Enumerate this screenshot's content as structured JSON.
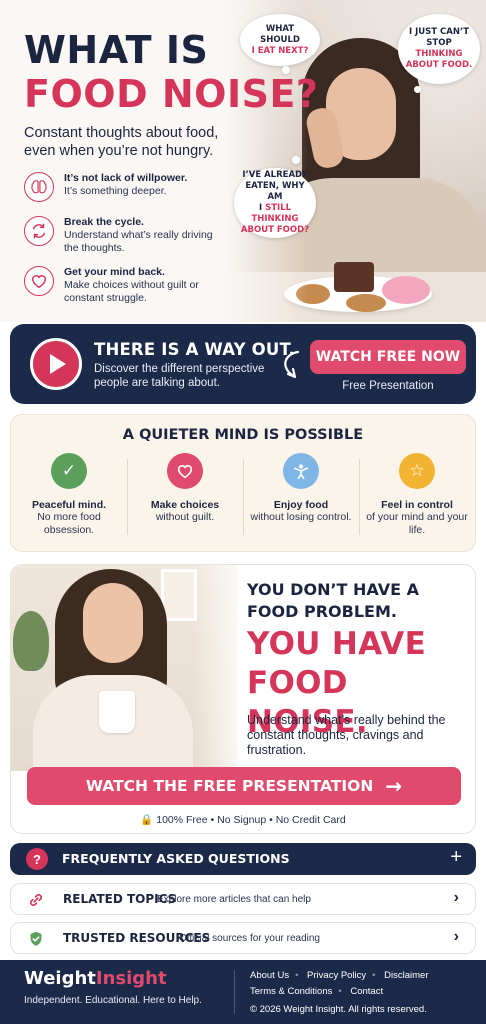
{
  "hero": {
    "title_line1": "WHAT IS",
    "title_line2": "FOOD NOISE?",
    "subtitle": "Constant thoughts about food, even when you’re not hungry.",
    "bubbles": {
      "b1_line1": "WHAT SHOULD",
      "b1_line2": "I EAT NEXT?",
      "b2_line1": "I JUST CAN’T",
      "b2_line2a": "STOP",
      "b2_line2b": "THINKING",
      "b2_line3": "ABOUT FOOD.",
      "b3_line1": "I’VE ALREADY",
      "b3_line2": "EATEN, WHY AM",
      "b3_line3a": "I",
      "b3_line3b": "STILL THINKING",
      "b3_line4": "ABOUT FOOD?"
    },
    "features": [
      {
        "title": "It’s not lack of willpower.",
        "text": "It’s something deeper.",
        "icon": "brain-icon"
      },
      {
        "title": "Break the cycle.",
        "text": "Understand what’s really driving the thoughts.",
        "icon": "cycle-icon"
      },
      {
        "title": "Get your mind back.",
        "text": "Make choices without guilt or constant struggle.",
        "icon": "heart-icon"
      }
    ]
  },
  "wayout": {
    "heading": "THERE IS A WAY OUT.",
    "text": "Discover the different perspective people are talking about.",
    "button": "WATCH FREE NOW",
    "button_sub": "Free Presentation"
  },
  "quiet": {
    "heading": "A QUIETER MIND IS POSSIBLE",
    "items": [
      {
        "title": "Peaceful mind.",
        "text": "No more food obsession.",
        "color": "#5aa05a",
        "icon": "check-icon"
      },
      {
        "title": "Make choices",
        "text": "without guilt.",
        "color": "#e04a6c",
        "icon": "heart-icon"
      },
      {
        "title": "Enjoy food",
        "text": "without losing control.",
        "color": "#7fb6e6",
        "icon": "person-icon"
      },
      {
        "title": "Feel in control",
        "text": "of your mind and your life.",
        "color": "#f2b232",
        "icon": "star-icon"
      }
    ]
  },
  "foodnoise": {
    "line1": "YOU DON’T HAVE A",
    "line2": "FOOD PROBLEM.",
    "big1": "YOU HAVE",
    "big2": "FOOD NOISE.",
    "desc": "Understand what’s really behind the constant thoughts, cravings and frustration.",
    "button": "WATCH THE FREE PRESENTATION",
    "foot1": "100% Free",
    "foot2": "No Signup",
    "foot3": "No Credit Card"
  },
  "faq": {
    "label": "FREQUENTLY ASKED QUESTIONS"
  },
  "related": {
    "label": "RELATED TOPICS",
    "sub": "Explore more articles that can help"
  },
  "trusted": {
    "label": "TRUSTED RESOURCES",
    "sub": "Official sources for your reading"
  },
  "footer": {
    "brand_a": "Weight",
    "brand_b": "Insight",
    "tagline": "Independent. Educational. Here to Help.",
    "links": [
      "About Us",
      "Privacy Policy",
      "Disclaimer",
      "Terms & Conditions",
      "Contact"
    ],
    "copyright": "© 2026 Weight Insight. All rights reserved."
  },
  "colors": {
    "navy": "#1c2a4a",
    "accent": "#d6355a",
    "button": "#e04a6c"
  }
}
